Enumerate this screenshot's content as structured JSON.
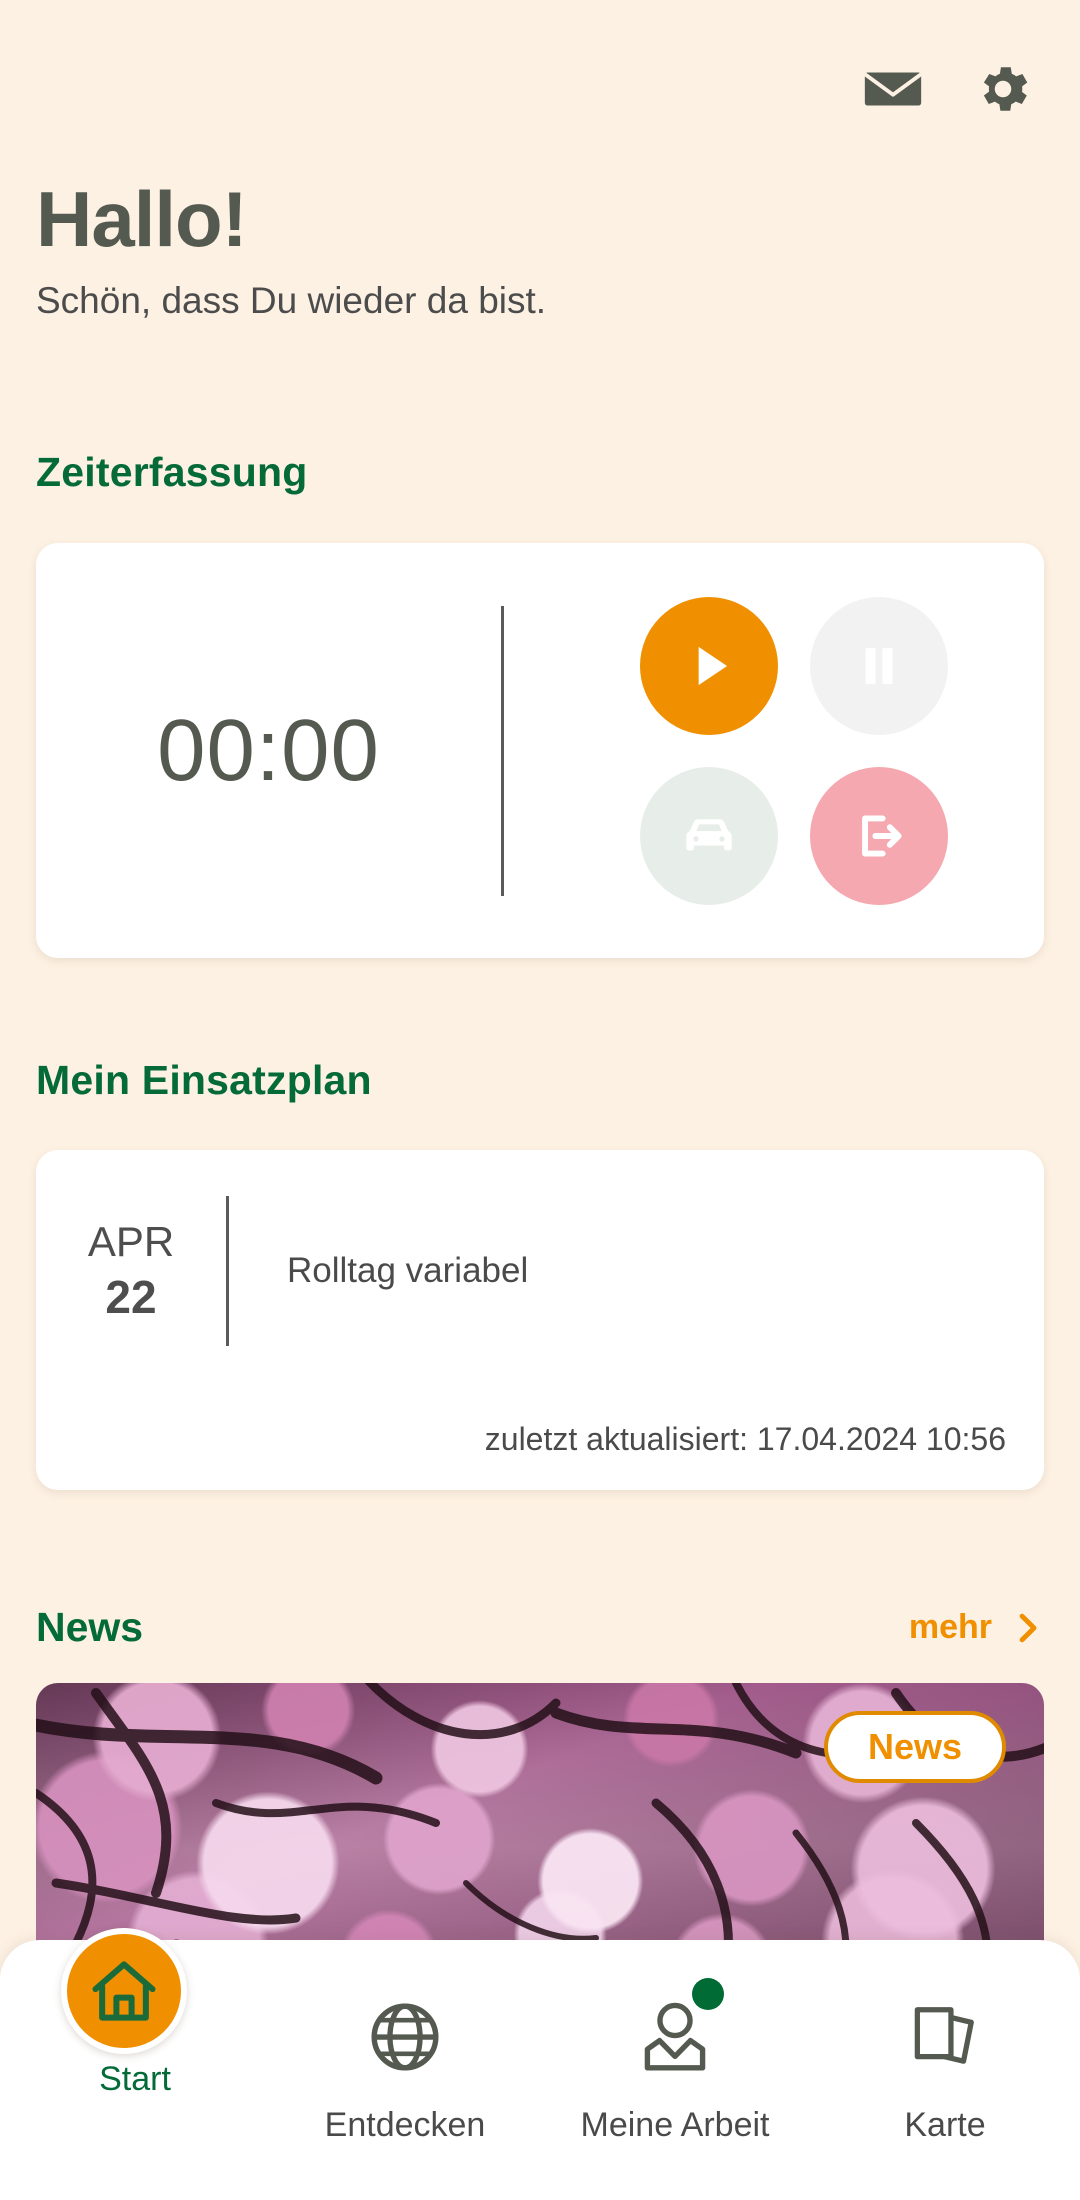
{
  "app": {
    "background_color": "#FDF1E3",
    "accent_orange": "#F09000",
    "accent_green": "#046A38",
    "accent_pink": "#F5A8B0"
  },
  "topbar": {
    "mail_icon": "mail-icon",
    "settings_icon": "gear-icon"
  },
  "greeting": {
    "title": "Hallo!",
    "subtitle": "Schön, dass Du wieder da bist."
  },
  "time_tracking": {
    "section_title": "Zeiterfassung",
    "timer_value": "00:00",
    "buttons": [
      {
        "name": "play",
        "icon": "play-icon",
        "color": "#F09000",
        "state": "enabled"
      },
      {
        "name": "pause",
        "icon": "pause-icon",
        "color": "#F2F2F3",
        "state": "disabled"
      },
      {
        "name": "drive",
        "icon": "car-icon",
        "color": "#E7EDE8",
        "state": "disabled"
      },
      {
        "name": "logout",
        "icon": "logout-icon",
        "color": "#F5A8B0",
        "state": "enabled"
      }
    ]
  },
  "deployment_plan": {
    "section_title": "Mein Einsatzplan",
    "entry": {
      "month": "APR",
      "day": "22",
      "description": "Rolltag variabel"
    },
    "last_updated": "zuletzt aktualisiert: 17.04.2024 10:56"
  },
  "news": {
    "section_title": "News",
    "more_label": "mehr",
    "more_icon": "chevron-right-icon",
    "badge_label": "News",
    "image_alt": "cherry-blossom-photo"
  },
  "bottom_nav": {
    "items": [
      {
        "label": "Start",
        "icon": "home-icon",
        "active": true,
        "badge": false
      },
      {
        "label": "Entdecken",
        "icon": "globe-icon",
        "active": false,
        "badge": false
      },
      {
        "label": "Meine Arbeit",
        "icon": "person-icon",
        "active": false,
        "badge": true
      },
      {
        "label": "Karte",
        "icon": "cards-icon",
        "active": false,
        "badge": false
      }
    ]
  }
}
